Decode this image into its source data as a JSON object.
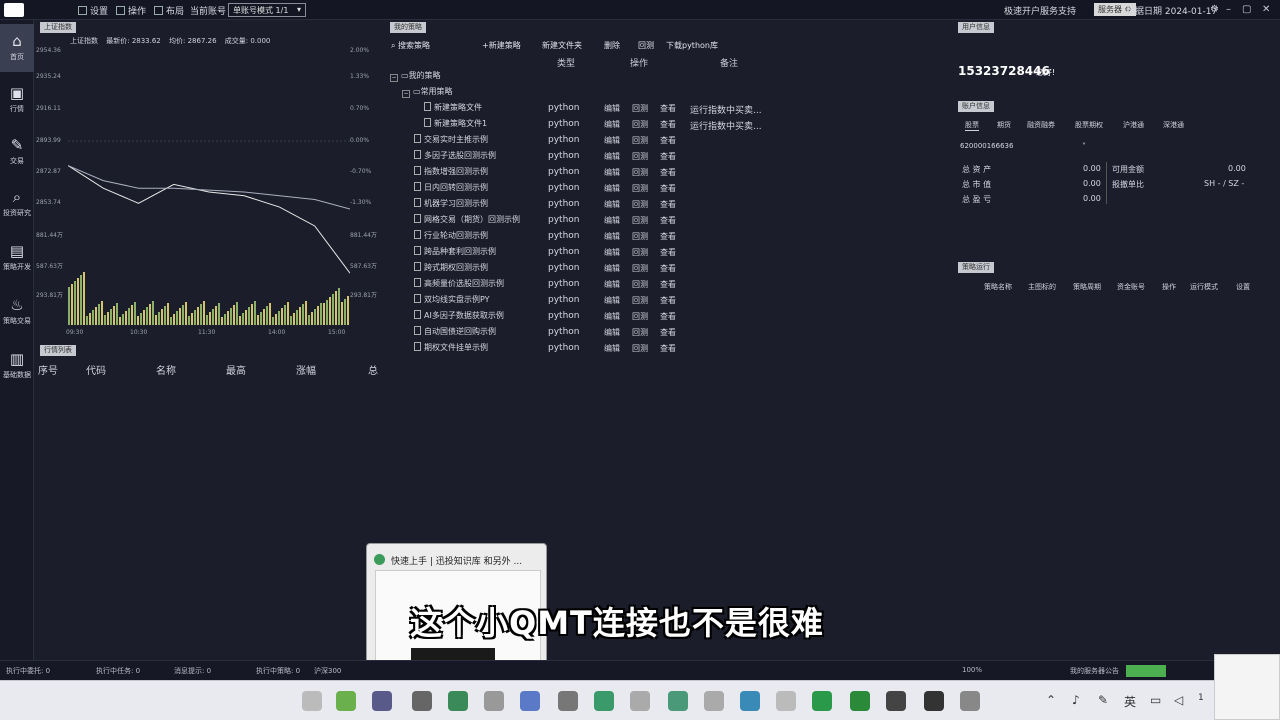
{
  "topbar": {
    "settings_label": "设置",
    "operate_label": "操作",
    "layout_label": "布局",
    "current_account_label": "当前账号",
    "mode_select_value": "单账号模式 1/1",
    "open_account_label": "极速开户",
    "service_label": "服务支持",
    "badge_label": "服务器 ⚙",
    "data_date": "数据日期 2024-01-17"
  },
  "sidebar": {
    "items": [
      {
        "label": "首页",
        "icon": "home-icon"
      },
      {
        "label": "行情",
        "icon": "market-icon"
      },
      {
        "label": "交易",
        "icon": "trade-icon"
      },
      {
        "label": "投资研究",
        "icon": "research-icon"
      },
      {
        "label": "策略开发",
        "icon": "strategy-icon"
      },
      {
        "label": "策略交易",
        "icon": "strategy-trade-icon"
      },
      {
        "label": "基础数据",
        "icon": "data-icon"
      }
    ]
  },
  "chart_panel": {
    "tag": "上证指数",
    "header_name": "上证指数",
    "latest_price": "最新价: 2833.62",
    "avg_price": "均价: 2867.26",
    "volume": "成交量: 0.000",
    "y_left": [
      "2954.36",
      "2935.24",
      "2916.11",
      "2893.99",
      "2872.87",
      "2853.74"
    ],
    "y_right": [
      "2.00%",
      "1.33%",
      "0.70%",
      "0.00%",
      "-0.70%",
      "-1.30%"
    ],
    "vol_left": [
      "881.44万",
      "587.63万",
      "293.81万"
    ],
    "vol_right": [
      "881.44万",
      "587.63万",
      "293.81万"
    ],
    "x_ticks": [
      "09:30",
      "10:30",
      "11:30",
      "14:00",
      "15:00"
    ]
  },
  "chart_data": {
    "type": "line",
    "title": "",
    "xlabel": "",
    "ylabel": "",
    "x": [
      "09:30",
      "10:00",
      "10:30",
      "11:00",
      "11:30",
      "13:30",
      "14:00",
      "14:30",
      "15:00"
    ],
    "series": [
      {
        "name": "",
        "values": [
          2890,
          2878,
          2870,
          2880,
          2876,
          2874,
          2868,
          2858,
          2833
        ]
      },
      {
        "name": "",
        "values": [
          2890,
          2882,
          2878,
          2878,
          2877,
          2876,
          2874,
          2872,
          2867
        ]
      }
    ],
    "ylim": [
      2853.74,
      2954.36
    ]
  },
  "quote_table": {
    "tag": "行情列表",
    "headers": [
      "序号",
      "代码",
      "名称",
      "最高",
      "涨幅",
      "总"
    ]
  },
  "strategy_panel": {
    "tag": "我的策略",
    "search_label": "搜索策略",
    "new_strategy": "+新建策略",
    "new_folder": "新建文件夹",
    "delete": "删除",
    "backtest": "回测",
    "download_python": "下载python库",
    "col_type": "类型",
    "col_operate": "操作",
    "col_note": "备注",
    "root": "我的策略",
    "folder": "常用策略",
    "action_labels": [
      "编辑",
      "回测",
      "查看"
    ],
    "rows": [
      {
        "name": "新建策略文件",
        "type": "python",
        "note": "运行指数中买卖..."
      },
      {
        "name": "新建策略文件1",
        "type": "python",
        "note": "运行指数中买卖..."
      },
      {
        "name": "交易实时主推示例",
        "type": "python",
        "note": ""
      },
      {
        "name": "多因子选股回测示例",
        "type": "python",
        "note": ""
      },
      {
        "name": "指数增强回测示例",
        "type": "python",
        "note": ""
      },
      {
        "name": "日内回转回测示例",
        "type": "python",
        "note": ""
      },
      {
        "name": "机器学习回测示例",
        "type": "python",
        "note": ""
      },
      {
        "name": "网格交易（期货）回测示例",
        "type": "python",
        "note": ""
      },
      {
        "name": "行业轮动回测示例",
        "type": "python",
        "note": ""
      },
      {
        "name": "跨品种套利回测示例",
        "type": "python",
        "note": ""
      },
      {
        "name": "跨式期权回测示例",
        "type": "python",
        "note": ""
      },
      {
        "name": "高频量价选股回测示例",
        "type": "python",
        "note": ""
      },
      {
        "name": "双均线实盘示例PY",
        "type": "python",
        "note": ""
      },
      {
        "name": "AI多因子数据获取示例",
        "type": "python",
        "note": ""
      },
      {
        "name": "自动国债逆回购示例",
        "type": "python",
        "note": ""
      },
      {
        "name": "期权文件挂单示例",
        "type": "python",
        "note": ""
      }
    ]
  },
  "user_panel": {
    "tag": "用户信息",
    "phone": "15323728446",
    "greeting": "您好!"
  },
  "account_panel": {
    "tag": "账户信息",
    "tabs": [
      "股票",
      "期货",
      "融资融券",
      "股票期权",
      "沪港通",
      "深港通"
    ],
    "account_id": "620000166636",
    "total_assets_label": "总 资 产",
    "total_assets": "0.00",
    "total_market_label": "总 市 值",
    "total_market": "0.00",
    "total_pnl_label": "总 盈 亏",
    "total_pnl": "0.00",
    "available_label": "可用金额",
    "available": "0.00",
    "report_label": "报撤单比",
    "report_value": "SH - / SZ -"
  },
  "strategy_run_panel": {
    "tag": "策略运行",
    "headers": [
      "策略名称",
      "主图标的",
      "策略周期",
      "资金账号",
      "操作",
      "运行模式",
      "设置"
    ]
  },
  "popup": {
    "title": "快速上手 | 迅投知识库 和另外 ..."
  },
  "subtitle": "这个小QMT连接也不是很难",
  "statusbar": {
    "items": [
      "执行中委托: 0",
      "执行中任务: 0",
      "消息提示: 0",
      "执行中策略: 0",
      "沪深300"
    ],
    "right_items": [
      "100%",
      "我的服务器公告"
    ]
  },
  "taskbar": {
    "tray_lang": "英",
    "clock": "1"
  }
}
